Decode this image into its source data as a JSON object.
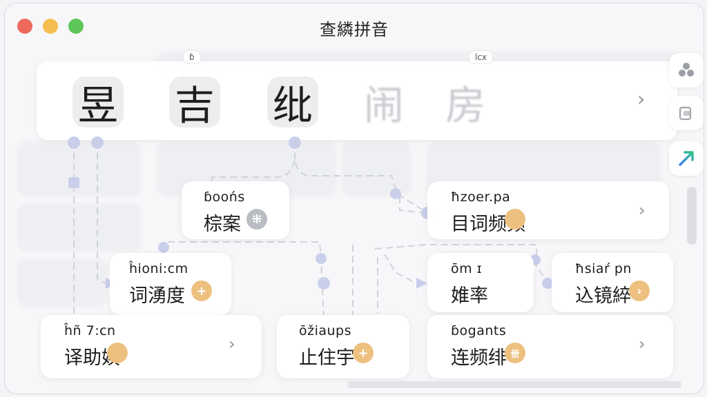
{
  "window": {
    "title": "查繗拼音"
  },
  "top_strip": {
    "tiles": [
      "昱",
      "吉",
      "纰"
    ],
    "faded": [
      "闹",
      "房"
    ],
    "tag_left": "ɓ",
    "tag_right": "lcx"
  },
  "cards": [
    {
      "id": "c1",
      "pinyin": "ɓoońs",
      "word": "棕案",
      "badge": "⁜",
      "badge_color": "gray"
    },
    {
      "id": "c2",
      "pinyin": "ħzoer.pa",
      "word": "目词频频",
      "badge": "",
      "badge_color": "orange"
    },
    {
      "id": "c3",
      "pinyin": "ĥioni:cm",
      "word": "词湧度",
      "badge": "+",
      "badge_color": "orange"
    },
    {
      "id": "c4",
      "pinyin": "ōm ɪ",
      "word": "婎率",
      "badge": "",
      "badge_color": ""
    },
    {
      "id": "c5",
      "pinyin": "ħsiaŕ pn",
      "word": "込镜綷",
      "badge": "›",
      "badge_color": "orange"
    },
    {
      "id": "c6",
      "pinyin": "ĥñ 7:cn",
      "word": "译助娱",
      "badge": "",
      "badge_color": "orange"
    },
    {
      "id": "c7",
      "pinyin": "ōžiaups",
      "word": "止住宇",
      "badge": "+",
      "badge_color": "orange"
    },
    {
      "id": "c8",
      "pinyin": "ɓogants",
      "word": "连频绯",
      "badge": "卌",
      "badge_color": "orange"
    }
  ],
  "colors": {
    "accent_blue": "#c7cdea",
    "badge_orange": "#edc07f",
    "connector": "#d6d8dc"
  }
}
